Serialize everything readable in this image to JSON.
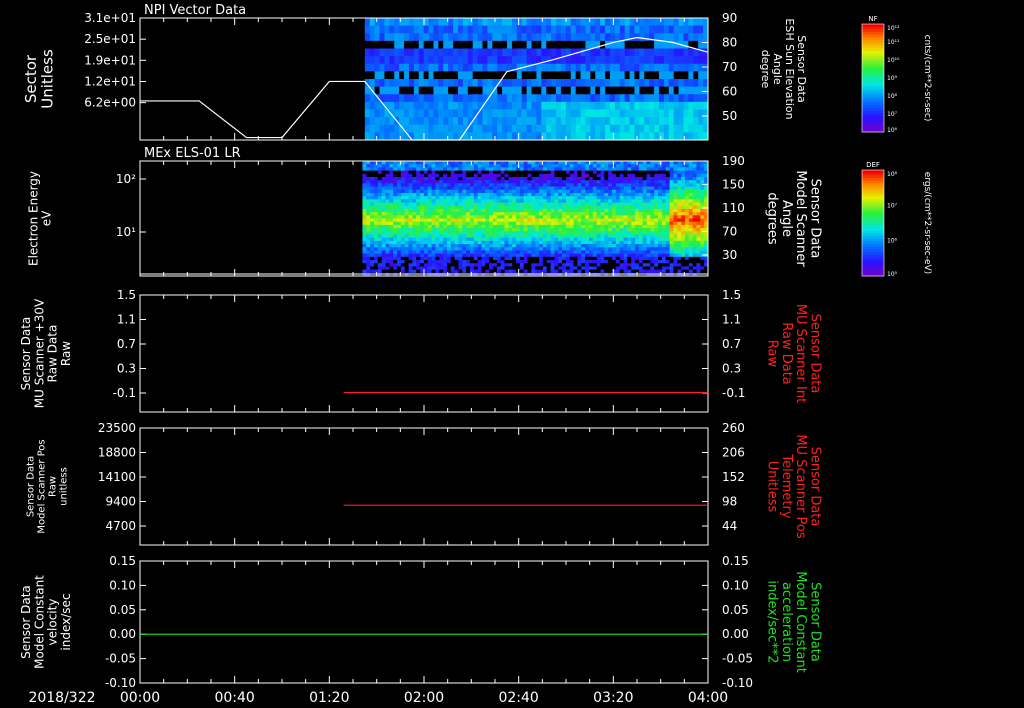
{
  "date_label": "2018/322",
  "time_ticks": [
    "00:00",
    "00:40",
    "01:20",
    "02:00",
    "02:40",
    "03:20",
    "04:00"
  ],
  "panels": [
    {
      "title": "NPI Vector Data",
      "left_label": [
        "Sector",
        "Unitless"
      ],
      "left_ticks": [
        "3.1e+01",
        "2.5e+01",
        "1.9e+01",
        "1.2e+01",
        "6.2e+00"
      ],
      "right_label": [
        "Sensor Data",
        "ESH Sun Elevation",
        "Angle",
        "degree"
      ],
      "right_label_color": "#ffffff",
      "right_ticks": [
        "90",
        "80",
        "70",
        "60",
        "50"
      ],
      "colorbar": {
        "tag": "NF",
        "top": "10¹²",
        "mid": [
          "10¹¹",
          "10¹⁰",
          "10⁹",
          "10⁸",
          "10⁷"
        ],
        "bottom": "10⁶",
        "unit": "cnts/(cm**2-sr-sec)"
      }
    },
    {
      "title": "MEx ELS-01 LR",
      "left_label": [
        "Electron Energy",
        "eV"
      ],
      "left_ticks": [
        "10²",
        "10¹"
      ],
      "right_label": [
        "Sensor Data",
        "Model Scanner",
        "Angle",
        "degrees"
      ],
      "right_label_color": "#ffffff",
      "right_ticks": [
        "190",
        "150",
        "110",
        "70",
        "30"
      ],
      "colorbar": {
        "tag": "DEF",
        "top": "10⁸",
        "mid": [
          "10⁷",
          "10⁶"
        ],
        "bottom": "10⁵",
        "unit": "ergs/(cm**2-sr-sec-eV)"
      }
    },
    {
      "title": "",
      "left_label": [
        "Sensor Data",
        "MU Scanner +30V",
        "Raw Data",
        "Raw"
      ],
      "left_ticks": [
        "1.5",
        "1.1",
        "0.7",
        "0.3",
        "-0.1"
      ],
      "right_label": [
        "Sensor Data",
        "MU Scanner Int",
        "Raw Data",
        "Raw"
      ],
      "right_label_color": "#ff2020",
      "right_ticks": [
        "1.5",
        "1.1",
        "0.7",
        "0.3",
        "-0.1"
      ]
    },
    {
      "title": "",
      "left_label": [
        "Sensor Data",
        "Model Scanner Pos",
        "Raw",
        "unitless"
      ],
      "left_ticks": [
        "23500",
        "18800",
        "14100",
        "9400",
        "4700"
      ],
      "right_label": [
        "Sensor Data",
        "MU Scanner Pos",
        "Telemetry",
        "Unitless"
      ],
      "right_label_color": "#ff2020",
      "right_ticks": [
        "260",
        "206",
        "152",
        "98",
        "44"
      ]
    },
    {
      "title": "",
      "left_label": [
        "Sensor Data",
        "Model Constant",
        "velocity",
        "index/sec"
      ],
      "left_ticks": [
        "0.15",
        "0.10",
        "0.05",
        "0.00",
        "-0.05",
        "-0.10"
      ],
      "right_label": [
        "Sensor Data",
        "Model Constant",
        "acceleration",
        "index/sec**2"
      ],
      "right_label_color": "#20e020",
      "right_ticks": [
        "0.15",
        "0.10",
        "0.05",
        "0.00",
        "-0.05",
        "-0.10"
      ]
    }
  ],
  "chart_data": [
    {
      "type": "heatmap",
      "title": "NPI Vector Data",
      "xlabel": "2018/322",
      "xlim": [
        "00:00",
        "04:00"
      ],
      "ylabel": "Sector Unitless",
      "y2label": "Sensor Data ESH Sun Elevation Angle degree",
      "y2lim": [
        40,
        90
      ],
      "data_start": "01:35",
      "overlay_line": {
        "color": "#ffffff",
        "x": [
          "00:00",
          "00:25",
          "00:45",
          "01:00",
          "01:20",
          "01:30",
          "01:35",
          "01:45",
          "01:55",
          "02:05",
          "02:15",
          "02:35",
          "02:55",
          "03:20",
          "03:30",
          "03:45",
          "04:00"
        ],
        "y": [
          56,
          56,
          41,
          41,
          64,
          64,
          64,
          52,
          40,
          40,
          40,
          68,
          73,
          80,
          82,
          80,
          76
        ]
      }
    },
    {
      "type": "heatmap",
      "title": "MEx ELS-01 LR",
      "xlabel": "2018/322",
      "xlim": [
        "00:00",
        "04:00"
      ],
      "ylabel": "Electron Energy eV",
      "y2label": "Sensor Data Model Scanner Angle degrees",
      "y2lim": [
        10,
        190
      ],
      "data_start": "01:34",
      "overlay_line": {
        "color": "#ffffff",
        "x": [
          "00:00",
          "04:00"
        ],
        "y": [
          10,
          10
        ]
      }
    },
    {
      "type": "line",
      "xlim": [
        "00:00",
        "04:00"
      ],
      "ylim": [
        -0.3,
        1.5
      ],
      "series": [
        {
          "name": "MU Scanner Int Raw Data",
          "color": "#ff2020",
          "x": [
            "01:26",
            "04:00"
          ],
          "y": [
            0.0,
            0.0
          ]
        }
      ]
    },
    {
      "type": "line",
      "xlim": [
        "00:00",
        "04:00"
      ],
      "ylim": [
        0,
        23500
      ],
      "series": [
        {
          "name": "MU Scanner Pos Telemetry",
          "color": "#ff2020",
          "x": [
            "01:26",
            "04:00"
          ],
          "y": [
            8000,
            8000
          ]
        }
      ]
    },
    {
      "type": "line",
      "xlim": [
        "00:00",
        "04:00"
      ],
      "ylim": [
        -0.1,
        0.15
      ],
      "series": [
        {
          "name": "Model Constant velocity",
          "color": "#20e020",
          "x": [
            "00:00",
            "04:00"
          ],
          "y": [
            0.0,
            0.0
          ]
        }
      ]
    }
  ]
}
